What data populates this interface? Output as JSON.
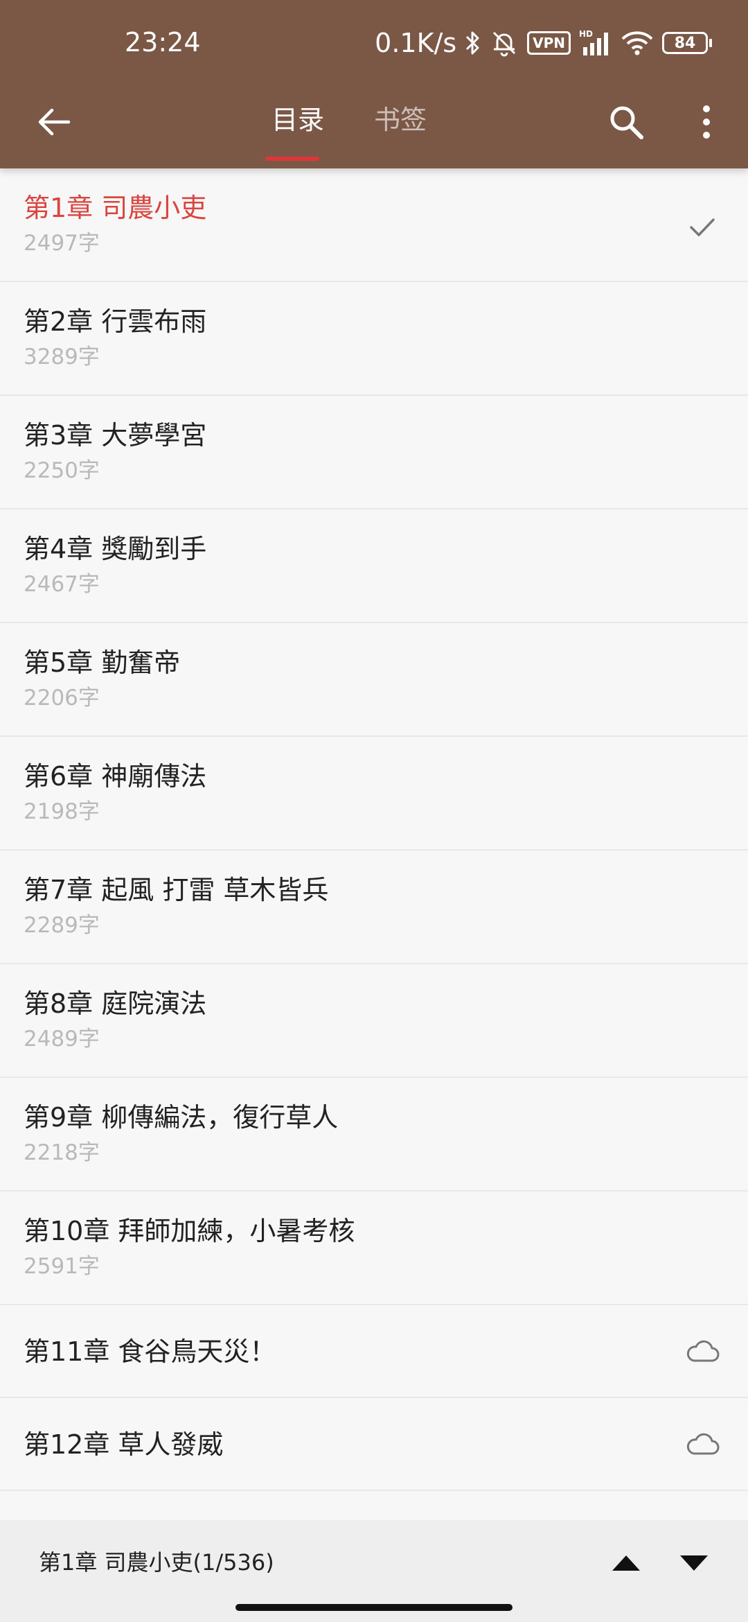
{
  "status_bar": {
    "time": "23:24",
    "net_speed": "0.1K/s",
    "vpn_label": "VPN",
    "hd_label": "HD",
    "battery": "84",
    "icons": [
      "bluetooth-icon",
      "mute-bell-icon",
      "vpn-icon",
      "signal-icon",
      "wifi-icon",
      "battery-icon"
    ]
  },
  "toolbar": {
    "back_icon": "arrow-left-icon",
    "tabs": [
      {
        "label": "目录",
        "active": true
      },
      {
        "label": "书签",
        "active": false
      }
    ],
    "search_icon": "search-icon",
    "more_icon": "more-vertical-icon"
  },
  "chapters": [
    {
      "title": "第1章 司農小吏",
      "count": "2497字",
      "state": "current"
    },
    {
      "title": "第2章 行雲布雨",
      "count": "3289字"
    },
    {
      "title": "第3章 大夢學宮",
      "count": "2250字"
    },
    {
      "title": "第4章 獎勵到手",
      "count": "2467字"
    },
    {
      "title": "第5章 勤奮帝",
      "count": "2206字"
    },
    {
      "title": "第6章 神廟傳法",
      "count": "2198字"
    },
    {
      "title": "第7章 起風 打雷 草木皆兵",
      "count": "2289字"
    },
    {
      "title": "第8章 庭院演法",
      "count": "2489字"
    },
    {
      "title": "第9章 柳傳編法，復行草人",
      "count": "2218字"
    },
    {
      "title": "第10章 拜師加練，小暑考核",
      "count": "2591字"
    },
    {
      "title": "第11章 食谷鳥天災！",
      "state": "cloud"
    },
    {
      "title": "第12章 草人發威",
      "state": "cloud"
    }
  ],
  "bottom_bar": {
    "current_chapter": "第1章 司農小吏(1/536)",
    "up_icon": "triangle-up-icon",
    "down_icon": "triangle-down-icon"
  },
  "colors": {
    "header_bg": "#7b5746",
    "accent_red": "#d9443f",
    "indicator": "#e0363a"
  }
}
